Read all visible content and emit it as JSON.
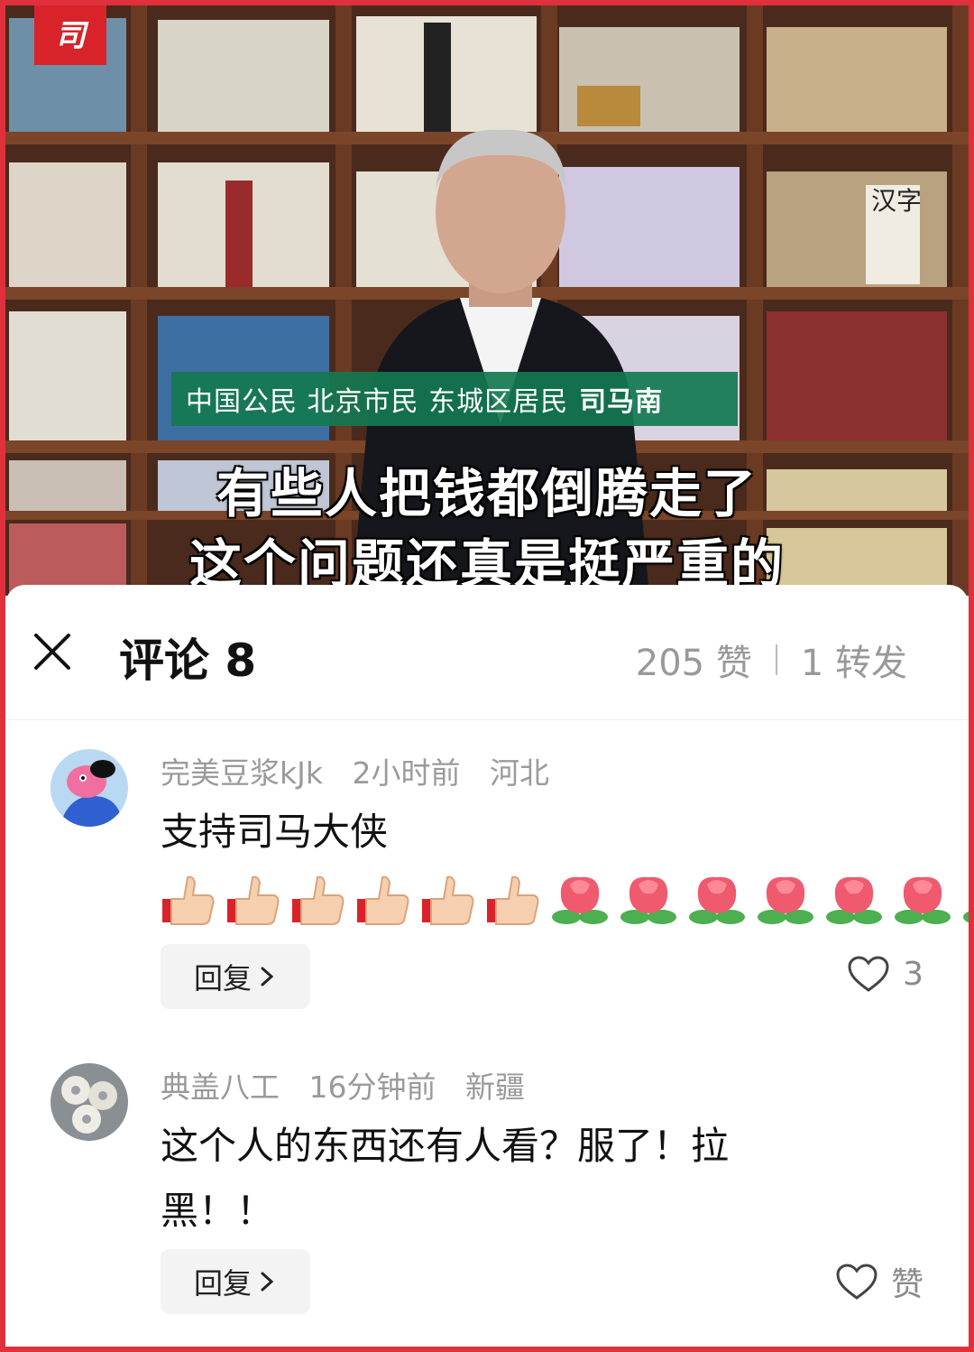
{
  "video": {
    "logo_char": "司",
    "name_tag_prefix": "中国公民 北京市民 东城区居民",
    "name_tag_name": "司马南",
    "subtitle_line1": "有些人把钱都倒腾走了",
    "subtitle_line2": "这个问题还真是挺严重的",
    "shelf_book_text": "汉字"
  },
  "sheet": {
    "title": "评论 8",
    "likes": "205 赞",
    "shares": "1 转发"
  },
  "comments": [
    {
      "nickname": "完美豆浆kJk",
      "time": "2小时前",
      "location": "河北",
      "text": "支持司马大侠",
      "emoji_thumbs": 6,
      "emoji_roses": 7,
      "reply_label": "回复",
      "like_count": "3",
      "avatar_icon": "cartoon-avatar-icon"
    },
    {
      "nickname": "典盖八工",
      "time": "16分钟前",
      "location": "新疆",
      "text": "这个人的东西还有人看？服了！拉黑！！",
      "reply_label": "回复",
      "like_label": "赞",
      "avatar_icon": "pattern-avatar-icon"
    }
  ],
  "colors": {
    "frame": "#e0303c",
    "name_tag_bg": "#14784f",
    "meta_text": "#9a9a9a"
  }
}
